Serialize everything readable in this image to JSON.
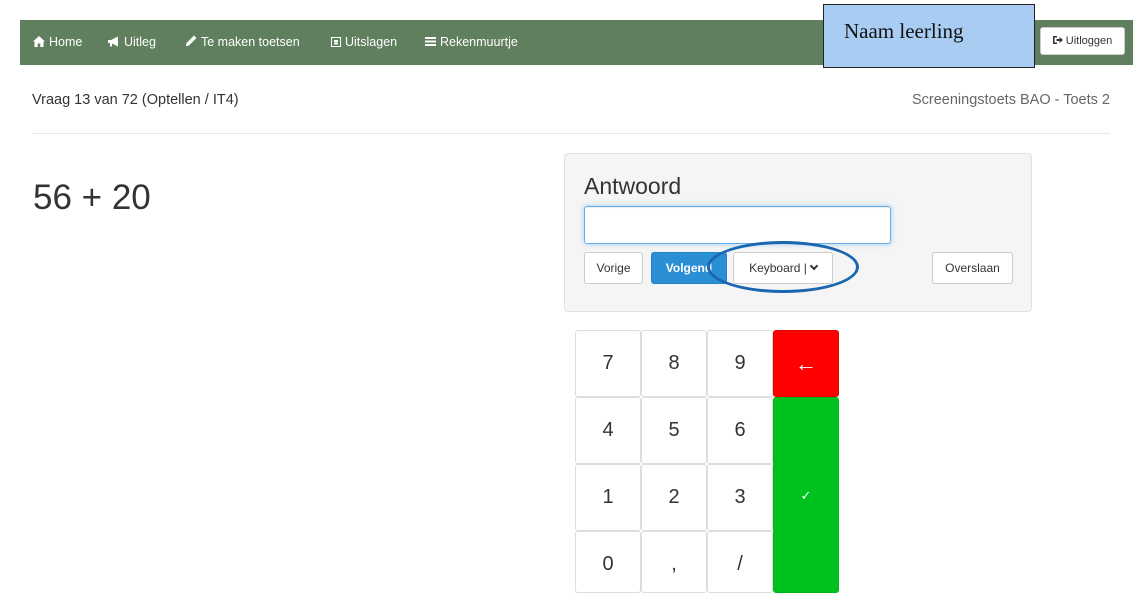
{
  "nav": {
    "items": [
      {
        "label": "Home",
        "icon": "home-icon"
      },
      {
        "label": "Uitleg",
        "icon": "megaphone-icon"
      },
      {
        "label": "Te maken toetsen",
        "icon": "pencil-icon"
      },
      {
        "label": "Uitslagen",
        "icon": "list-alt-icon"
      },
      {
        "label": "Rekenmuurtje",
        "icon": "bars-icon"
      }
    ],
    "student_name": "Naam leerling",
    "logout_label": "Uitloggen"
  },
  "header": {
    "question_info": "Vraag 13 van 72 (Optellen / IT4)",
    "test_name": "Screeningstoets BAO - Toets 2"
  },
  "question": {
    "sum": "56 + 20"
  },
  "answer_panel": {
    "title": "Antwoord",
    "input_value": "",
    "prev_label": "Vorige",
    "next_label": "Volgend",
    "keyboard_label": "Keyboard |",
    "skip_label": "Overslaan"
  },
  "keypad": {
    "keys": [
      "7",
      "8",
      "9",
      "4",
      "5",
      "6",
      "1",
      "2",
      "3",
      "0",
      ",",
      "/"
    ],
    "backspace": "←",
    "confirm": "✓"
  },
  "colors": {
    "navbar": "#5f7f5e",
    "primary": "#2b8fd6",
    "backspace": "#ff0000",
    "confirm": "#00c21e",
    "name_box": "#a9cdf2",
    "highlight": "#1b66b0"
  }
}
